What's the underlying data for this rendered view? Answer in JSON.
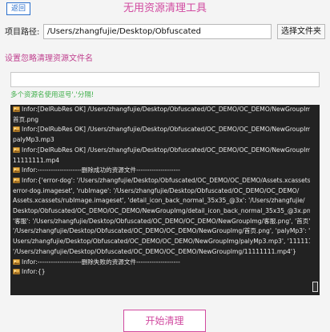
{
  "header": {
    "back_label": "返回",
    "title": "无用资源清理工具"
  },
  "path": {
    "label": "项目路径:",
    "value": "/Users/zhangfujie/Desktop/Obfuscated",
    "choose_label": "选择文件夹"
  },
  "ignore": {
    "label": "设置忽略清理资源文件名",
    "value": "",
    "hint": "多个资源名使用逗号','分隔!"
  },
  "log": {
    "lines": [
      {
        "icon": true,
        "text": "Infor:[DelRubRes OK] /Users/zhangfujie/Desktop/Obfuscated/OC_DEMO/OC_DEMO/NewGroupImg/"
      },
      {
        "icon": false,
        "text": "首页.png"
      },
      {
        "icon": true,
        "text": "Infor:[DelRubRes OK] /Users/zhangfujie/Desktop/Obfuscated/OC_DEMO/OC_DEMO/NewGroupImg/"
      },
      {
        "icon": false,
        "text": "palyMp3.mp3"
      },
      {
        "icon": true,
        "text": "Infor:[DelRubRes OK] /Users/zhangfujie/Desktop/Obfuscated/OC_DEMO/OC_DEMO/NewGroupImg/"
      },
      {
        "icon": false,
        "text": "11111111.mp4"
      },
      {
        "icon": true,
        "text": "Infor:--------------------删除成功的资源文件--------------------"
      },
      {
        "icon": true,
        "text": "Infor:{'error-dog': '/Users/zhangfujie/Desktop/Obfuscated/OC_DEMO/OC_DEMO/Assets.xcassets/"
      },
      {
        "icon": false,
        "text": "error-dog.imageset', 'rubImage': '/Users/zhangfujie/Desktop/Obfuscated/OC_DEMO/OC_DEMO/"
      },
      {
        "icon": false,
        "text": "Assets.xcassets/rubImage.imageset', 'detail_icon_back_normal_35x35_@3x': '/Users/zhangfujie/"
      },
      {
        "icon": false,
        "text": "Desktop/Obfuscated/OC_DEMO/OC_DEMO/NewGroupImg/detail_icon_back_normal_35x35_@3x.png',"
      },
      {
        "icon": false,
        "text": "'客服': '/Users/zhangfujie/Desktop/Obfuscated/OC_DEMO/OC_DEMO/NewGroupImg/客服.png', '首页':"
      },
      {
        "icon": false,
        "text": "'/Users/zhangfujie/Desktop/Obfuscated/OC_DEMO/OC_DEMO/NewGroupImg/首页.png', 'palyMp3': '/"
      },
      {
        "icon": false,
        "text": "Users/zhangfujie/Desktop/Obfuscated/OC_DEMO/OC_DEMO/NewGroupImg/palyMp3.mp3', '11111111':"
      },
      {
        "icon": false,
        "text": "'/Users/zhangfujie/Desktop/Obfuscated/OC_DEMO/OC_DEMO/NewGroupImg/11111111.mp4'}"
      },
      {
        "icon": true,
        "text": "Infor:--------------------删除失败的资源文件--------------------"
      },
      {
        "icon": true,
        "text": "Infor:{}"
      }
    ]
  },
  "actions": {
    "start_label": "开始清理"
  },
  "colors": {
    "accent": "#d14aa0",
    "hint": "#3fae4a",
    "back_button": "#2a6fcc",
    "log_background": "#222222"
  }
}
